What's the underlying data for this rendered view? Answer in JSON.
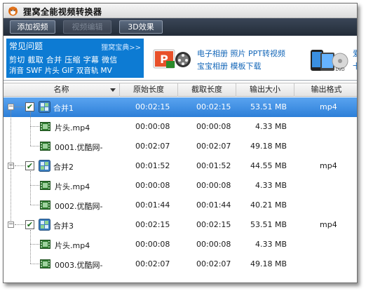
{
  "app": {
    "title": "狸窝全能视频转换器"
  },
  "toolbar": {
    "add_video": "添加视频",
    "edit_video": "视频编辑",
    "effect_3d": "3D效果"
  },
  "banner": {
    "faq_title": "常见问题",
    "faq_guide": "狸窝宝典>>",
    "faq_line1": "剪切 截取 合并 压缩 字幕 微信",
    "faq_line2": "消音 SWF 片头 GIF 双音轨 MV",
    "promo_line1": "电子相册  照片 PPT转视频",
    "promo_line2": "宝宝相册  模板下载",
    "promo_cut1": "爱",
    "promo_cut2": "卡"
  },
  "table": {
    "headers": {
      "name": "名称",
      "original_length": "原始长度",
      "cut_length": "截取长度",
      "output_size": "输出大小",
      "output_format": "输出格式"
    },
    "groups": [
      {
        "name": "合并1",
        "checked": true,
        "selected": true,
        "original_length": "00:02:15",
        "cut_length": "00:02:15",
        "output_size": "53.51 MB",
        "output_format": "mp4",
        "children": [
          {
            "name": "片头.mp4",
            "original_length": "00:00:08",
            "cut_length": "00:00:08",
            "output_size": "4.33 MB"
          },
          {
            "name": "0001.优酷网-",
            "original_length": "00:02:07",
            "cut_length": "00:02:07",
            "output_size": "49.18 MB"
          }
        ]
      },
      {
        "name": "合并2",
        "checked": true,
        "selected": false,
        "original_length": "00:01:52",
        "cut_length": "00:01:52",
        "output_size": "44.55 MB",
        "output_format": "mp4",
        "children": [
          {
            "name": "片头.mp4",
            "original_length": "00:00:08",
            "cut_length": "00:00:08",
            "output_size": "4.33 MB"
          },
          {
            "name": "0002.优酷网-",
            "original_length": "00:01:44",
            "cut_length": "00:01:44",
            "output_size": "40.21 MB"
          }
        ]
      },
      {
        "name": "合并3",
        "checked": true,
        "selected": false,
        "original_length": "00:02:15",
        "cut_length": "00:02:15",
        "output_size": "53.51 MB",
        "output_format": "mp4",
        "children": [
          {
            "name": "片头.mp4",
            "original_length": "00:00:08",
            "cut_length": "00:00:08",
            "output_size": "4.33 MB"
          },
          {
            "name": "0003.优酷网-",
            "original_length": "00:02:07",
            "cut_length": "00:02:07",
            "output_size": "49.18 MB"
          }
        ]
      }
    ]
  },
  "icons": {
    "app_logo": "fox-logo-icon",
    "checkbox": "checkmark-icon",
    "merge": "merge-video-icon",
    "file": "film-strip-icon",
    "sort": "sort-down-icon",
    "expander": "collapse-minus-icon"
  },
  "colors": {
    "toolbar_bg": "#2c3644",
    "faq_bg": "#0d7bd3",
    "selected_row": "#3d8fe4",
    "promo_link": "#1366b8"
  }
}
